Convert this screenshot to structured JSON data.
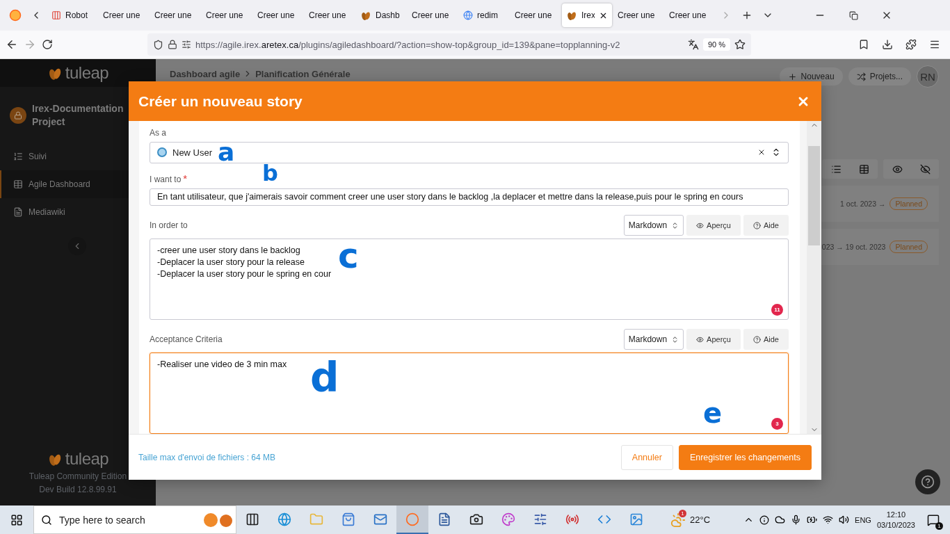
{
  "browser": {
    "tabs": [
      {
        "label": "Robot",
        "kind": "robot",
        "selected": false
      },
      {
        "label": "Creer une",
        "kind": "plain",
        "selected": false
      },
      {
        "label": "Creer une",
        "kind": "plain",
        "selected": false
      },
      {
        "label": "Creer une",
        "kind": "plain",
        "selected": false
      },
      {
        "label": "Creer une",
        "kind": "plain",
        "selected": false
      },
      {
        "label": "Creer une",
        "kind": "plain",
        "selected": false
      },
      {
        "label": "Dashb",
        "kind": "tuleap",
        "selected": false
      },
      {
        "label": "Creer une",
        "kind": "plain",
        "selected": false
      },
      {
        "label": "redim",
        "kind": "google",
        "selected": false
      },
      {
        "label": "Creer une",
        "kind": "plain",
        "selected": false
      },
      {
        "label": "Irex",
        "kind": "tuleap",
        "selected": true
      },
      {
        "label": "Creer une",
        "kind": "plain",
        "selected": false
      },
      {
        "label": "Creer une",
        "kind": "plain",
        "selected": false
      }
    ],
    "url": "https://agile.irex.**aretex.ca**/plugins/agiledashboard/?action=show-top&group_id=139&pane=topplanning-v2",
    "zoom": "90 %"
  },
  "sidebar": {
    "logo": "tuleap",
    "project": "Irex-Documentation Project",
    "items": [
      {
        "label": "Suivi",
        "kind": "tracker",
        "selected": false
      },
      {
        "label": "Agile Dashboard",
        "kind": "dashboard",
        "selected": true
      },
      {
        "label": "Mediawiki",
        "kind": "wiki",
        "selected": false
      }
    ],
    "footer_logo": "tuleap",
    "edition": "Tuleap Community Edition",
    "build": "Dev Build 12.8.99.91"
  },
  "page": {
    "breadcrumb": [
      "Dashboard agile",
      "Planification Générale"
    ],
    "new_button": "Nouveau",
    "projects_button": "Projets...",
    "avatar": "RN",
    "rows": [
      {
        "dates": "1 oct. 2023 →",
        "status": "Planned"
      },
      {
        "dates": "023 → 19 oct. 2023",
        "status": "Planned"
      }
    ]
  },
  "modal": {
    "title": "Créer un nouveau story",
    "fields": [
      {
        "kind": "select",
        "label": "As a",
        "value": "New User",
        "annotations": [
          "a"
        ]
      },
      {
        "kind": "input",
        "label": "I want to",
        "required_mark": "*",
        "value": "En tant utilisateur, que j'aimerais savoir comment creer une user story dans le backlog ,la deplacer et mettre dans la release,puis pour le spring en cours",
        "annotations": [
          "b"
        ]
      },
      {
        "kind": "markdown",
        "label": "In order to",
        "format": "Markdown",
        "preview": "Aperçu",
        "help": "Aide",
        "lines": [
          "-creer une user story dans le backlog",
          "-Deplacer la user story pour la release",
          "-Deplacer la user story pour le spring en cour"
        ],
        "badge": "11",
        "focused": false,
        "annotations": [
          "c"
        ]
      },
      {
        "kind": "markdown",
        "label": "Acceptance Criteria",
        "format": "Markdown",
        "preview": "Aperçu",
        "help": "Aide",
        "lines": [
          "-Realiser une video de 3 min max"
        ],
        "badge": "3",
        "focused": true,
        "annotations": [
          "d",
          "e"
        ]
      }
    ],
    "footer_note": "Taille max d'envoi de fichiers : 64 MB",
    "buttons": [
      {
        "label": "Annuler",
        "kind": "secondary"
      },
      {
        "label": "Enregistrer les changements",
        "kind": "primary"
      }
    ]
  },
  "taskbar": {
    "search_placeholder": "Type here to search",
    "apps": [
      {
        "kind": "taskview",
        "selected": false
      },
      {
        "kind": "edge",
        "selected": false
      },
      {
        "kind": "files",
        "selected": false
      },
      {
        "kind": "store",
        "selected": false
      },
      {
        "kind": "mail",
        "selected": false
      },
      {
        "kind": "firefox",
        "selected": true
      },
      {
        "kind": "word",
        "selected": false
      },
      {
        "kind": "obs",
        "selected": false
      },
      {
        "kind": "paint",
        "selected": false
      },
      {
        "kind": "tool",
        "selected": false
      },
      {
        "kind": "radio",
        "selected": false
      },
      {
        "kind": "code",
        "selected": false
      },
      {
        "kind": "photos",
        "selected": false
      }
    ],
    "weather_badge": "1",
    "weather": "22°C",
    "language": "ENG",
    "time": "12:10",
    "date": "03/10/2023",
    "notification_badge": "1"
  }
}
